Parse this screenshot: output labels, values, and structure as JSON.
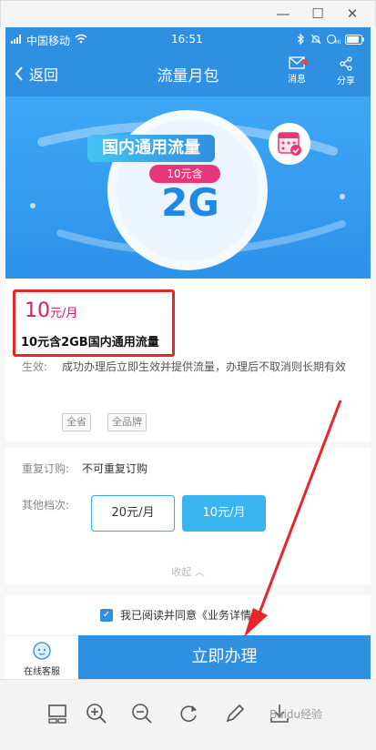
{
  "window": {
    "minimize_glyph": "—",
    "maximize_glyph": "☐",
    "close_glyph": "✕"
  },
  "status_bar": {
    "carrier": "中国移动",
    "time": "16:51"
  },
  "nav": {
    "back_label": "返回",
    "title": "流量月包",
    "message_label": "消息",
    "share_label": "分享"
  },
  "banner": {
    "headline": "国内通用流量",
    "pill": "10元含",
    "big": "2G"
  },
  "product": {
    "price": "10",
    "price_unit": "元/月",
    "name": "10元含2GB国内通用流量",
    "effect_label": "生效:",
    "effect_text": "成功办理后立即生效并提供流量，办理后不取消则长期有效",
    "tags": [
      "全省",
      "全品牌"
    ]
  },
  "options": {
    "repeat_label": "重复订购:",
    "repeat_value": "不可重复订购",
    "tiers_label": "其他档次:",
    "tiers": [
      "20元/月",
      "10元/月"
    ],
    "collapse_label": "收起"
  },
  "agreement": {
    "text": "我已阅读并同意《业务详情》"
  },
  "bottom": {
    "service_label": "在线客服",
    "apply_label": "立即办理"
  },
  "watermark": "Baidu经验",
  "colors": {
    "primary": "#2f8fe0",
    "price": "#e0196f",
    "highlight_box": "#e8242c",
    "arrow": "#e8242c"
  }
}
